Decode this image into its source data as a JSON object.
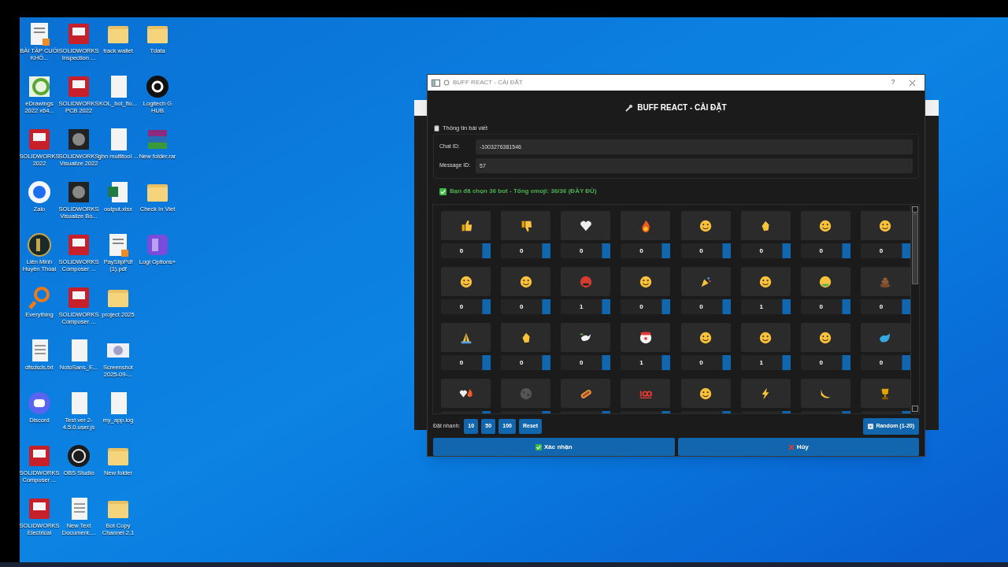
{
  "desktop": {
    "columns": [
      [
        {
          "label": "BÀI TẬP CUỐI KHÓ...",
          "kind": "pdf"
        },
        {
          "label": "eDrawings 2022 x64...",
          "kind": "edrawings"
        },
        {
          "label": "SOLIDWORKS 2022",
          "kind": "sw"
        },
        {
          "label": "Zalo",
          "kind": "zalo"
        },
        {
          "label": "Liên Minh Huyền Thoại",
          "kind": "game"
        },
        {
          "label": "Everything",
          "kind": "search"
        },
        {
          "label": "dfsdsds.txt",
          "kind": "doc"
        },
        {
          "label": "Discord",
          "kind": "discord"
        },
        {
          "label": "SOLIDWORKS Composer ...",
          "kind": "sw"
        },
        {
          "label": "SOLIDWORKS Electrical",
          "kind": "sw"
        }
      ],
      [
        {
          "label": "SOLIDWORKS Inspection ...",
          "kind": "sw"
        },
        {
          "label": "SOLIDWORKS PCB 2022",
          "kind": "sw"
        },
        {
          "label": "SOLIDWORKS Visualize 2022",
          "kind": "dark"
        },
        {
          "label": "SOLIDWORKS Visualize Bo...",
          "kind": "dark"
        },
        {
          "label": "SOLIDWORKS Composer ...",
          "kind": "sw"
        },
        {
          "label": "SOLIDWORKS Composer ...",
          "kind": "sw"
        },
        {
          "label": "NotoSans_E...",
          "kind": "file"
        },
        {
          "label": "Test ver 2-4.5.0.user.js",
          "kind": "file"
        },
        {
          "label": "OBS Studio",
          "kind": "obs"
        },
        {
          "label": "New Text Document....",
          "kind": "doc"
        }
      ],
      [
        {
          "label": "track wallet",
          "kind": "folder"
        },
        {
          "label": "KOL_bot_flo...",
          "kind": "file"
        },
        {
          "label": "ghn multitool ...",
          "kind": "file"
        },
        {
          "label": "output.xlsx",
          "kind": "excel"
        },
        {
          "label": "PaySlipPdf (1).pdf",
          "kind": "pdf"
        },
        {
          "label": "project 2025",
          "kind": "folder"
        },
        {
          "label": "Screenshot 2025-09-...",
          "kind": "image"
        },
        {
          "label": "my_app.log",
          "kind": "file"
        },
        {
          "label": "New folder",
          "kind": "folder"
        },
        {
          "label": "Bot Copy Channel 2.1",
          "kind": "folder"
        }
      ],
      [
        {
          "label": "Tdata",
          "kind": "folder"
        },
        {
          "label": "Logitech G HUB",
          "kind": "logitech"
        },
        {
          "label": "New folder.rar",
          "kind": "rar"
        },
        {
          "label": "Check In Viet",
          "kind": "folder"
        },
        {
          "label": "Logi Options+",
          "kind": "logi"
        }
      ]
    ]
  },
  "dialog": {
    "title": "BUFF REACT - CÀI ĐẶT",
    "help": "?",
    "heading": "BUFF REACT - CÀI ĐẶT",
    "group": {
      "title": "Thông tin bài viết",
      "fields": [
        {
          "label": "Chat ID:",
          "value": "-1003276381546"
        },
        {
          "label": "Message ID:",
          "value": "57"
        }
      ]
    },
    "status": "Bạn đã chọn 36 bot - Tổng emoji: 36/36 (ĐẦY ĐỦ)",
    "emojis": [
      {
        "kind": "thumbs-up",
        "count": "0"
      },
      {
        "kind": "thumbs-down",
        "count": "0"
      },
      {
        "kind": "heart",
        "count": "0"
      },
      {
        "kind": "fire",
        "count": "0"
      },
      {
        "kind": "face",
        "count": "0"
      },
      {
        "kind": "clap",
        "count": "0"
      },
      {
        "kind": "face",
        "count": "0"
      },
      {
        "kind": "face",
        "count": "0"
      },
      {
        "kind": "face",
        "count": "0"
      },
      {
        "kind": "face",
        "count": "0"
      },
      {
        "kind": "angry",
        "count": "1"
      },
      {
        "kind": "face",
        "count": "0"
      },
      {
        "kind": "party",
        "count": "0"
      },
      {
        "kind": "face",
        "count": "1"
      },
      {
        "kind": "sick",
        "count": "0"
      },
      {
        "kind": "poop",
        "count": "0"
      },
      {
        "kind": "pray",
        "count": "0"
      },
      {
        "kind": "clap",
        "count": "0"
      },
      {
        "kind": "dove",
        "count": "0"
      },
      {
        "kind": "clown",
        "count": "1"
      },
      {
        "kind": "face",
        "count": "0"
      },
      {
        "kind": "face",
        "count": "1"
      },
      {
        "kind": "face",
        "count": "0"
      },
      {
        "kind": "whale",
        "count": "0"
      },
      {
        "kind": "heart-fire"
      },
      {
        "kind": "moon"
      },
      {
        "kind": "hotdog"
      },
      {
        "kind": "hundred"
      },
      {
        "kind": "face"
      },
      {
        "kind": "bolt"
      },
      {
        "kind": "banana"
      },
      {
        "kind": "trophy"
      }
    ],
    "quick": {
      "label": "Đặt nhanh:",
      "buttons": [
        "10",
        "50",
        "100",
        "Reset"
      ],
      "random": "Random (1-20)"
    },
    "confirm": "Xác nhận",
    "cancel": "Hủy"
  }
}
